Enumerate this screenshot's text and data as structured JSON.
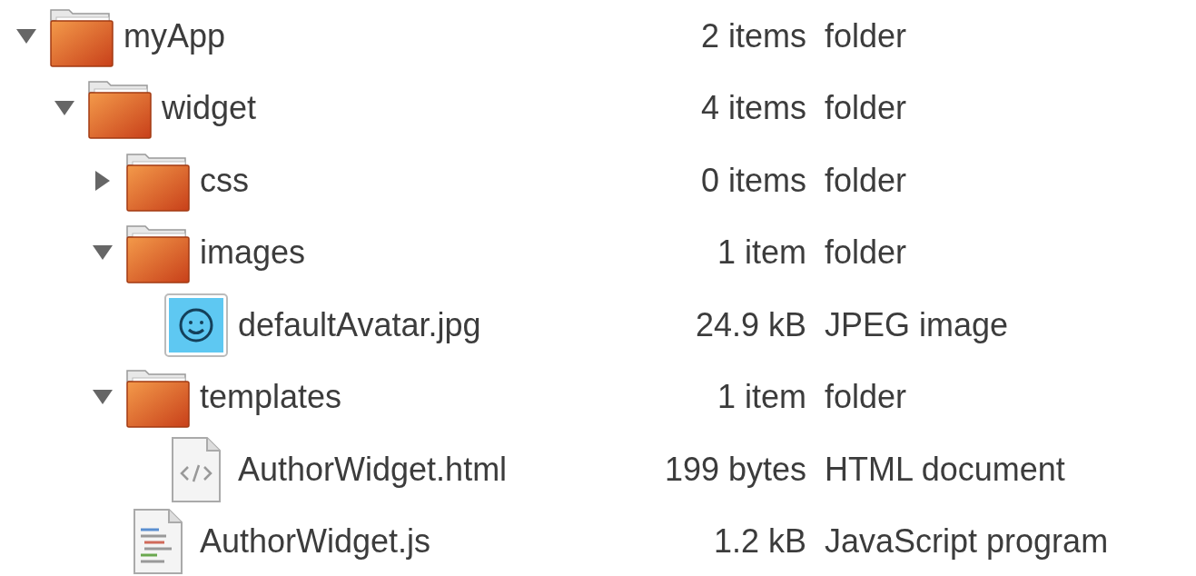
{
  "tree": [
    {
      "kind": "folder",
      "name": "myApp",
      "size": "2 items",
      "type": "folder",
      "expanded": true,
      "children": [
        {
          "kind": "folder",
          "name": "widget",
          "size": "4 items",
          "type": "folder",
          "expanded": true,
          "children": [
            {
              "kind": "folder",
              "name": "css",
              "size": "0 items",
              "type": "folder",
              "expanded": false
            },
            {
              "kind": "folder",
              "name": "images",
              "size": "1 item",
              "type": "folder",
              "expanded": true,
              "children": [
                {
                  "kind": "image",
                  "name": "defaultAvatar.jpg",
                  "size": "24.9 kB",
                  "type": "JPEG image"
                }
              ]
            },
            {
              "kind": "folder",
              "name": "templates",
              "size": "1 item",
              "type": "folder",
              "expanded": true,
              "children": [
                {
                  "kind": "html",
                  "name": "AuthorWidget.html",
                  "size": "199 bytes",
                  "type": "HTML document"
                }
              ]
            },
            {
              "kind": "js",
              "name": "AuthorWidget.js",
              "size": "1.2 kB",
              "type": "JavaScript program"
            }
          ]
        }
      ]
    }
  ]
}
